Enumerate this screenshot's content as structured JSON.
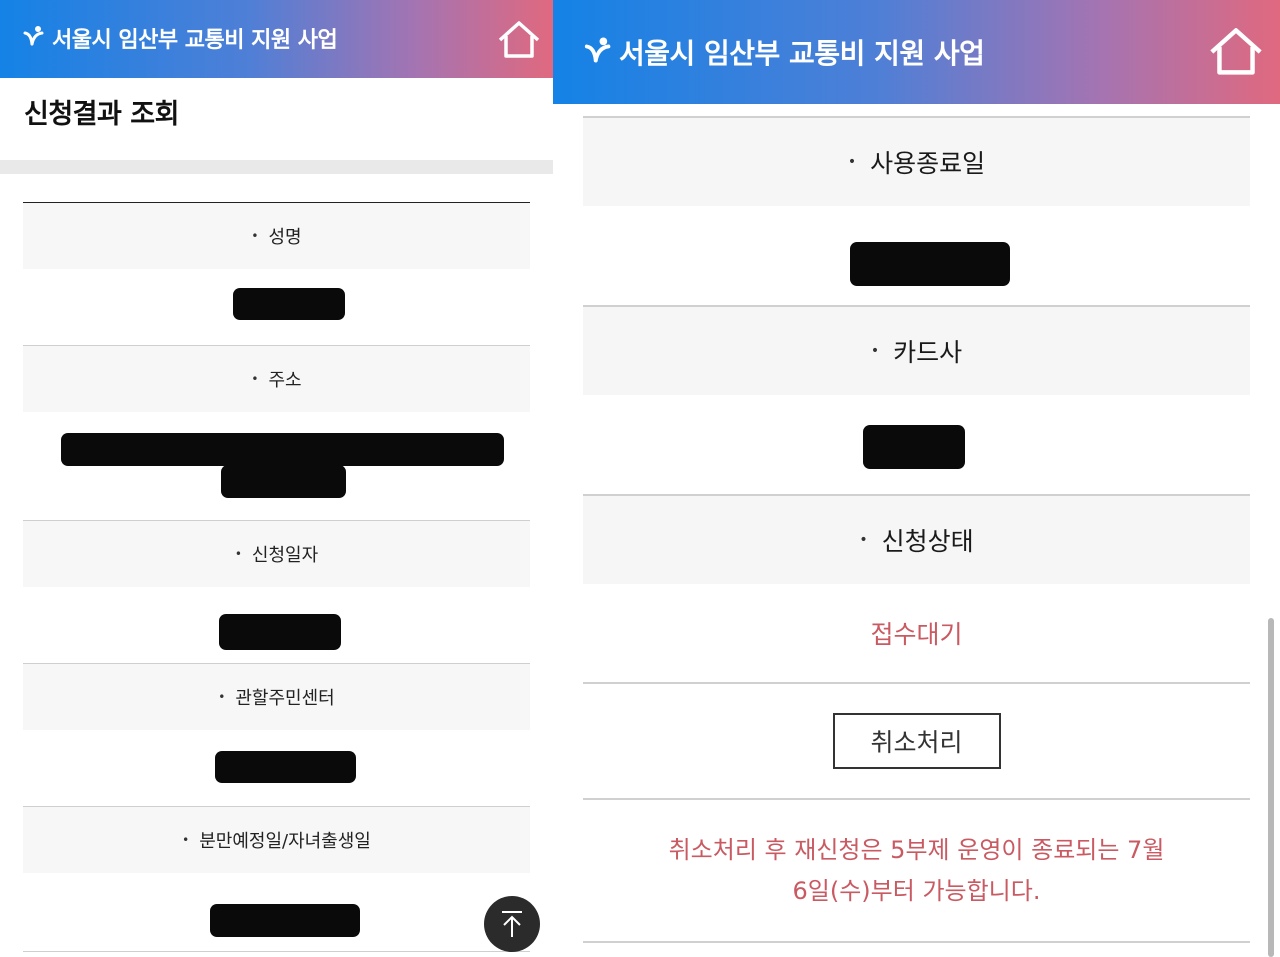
{
  "app": {
    "title": "서울시 임산부 교통비 지원 사업",
    "home_icon": "home-icon",
    "brand_icon": "seoul-logo-icon"
  },
  "left_screen": {
    "page_title": "신청결과 조회",
    "rows": [
      {
        "label": "성명"
      },
      {
        "label": "주소"
      },
      {
        "label": "신청일자"
      },
      {
        "label": "관할주민센터"
      },
      {
        "label": "분만예정일/자녀출생일"
      }
    ],
    "scroll_top_icon": "arrow-up-to-top-icon"
  },
  "right_screen": {
    "rows": [
      {
        "label": "사용종료일"
      },
      {
        "label": "카드사"
      },
      {
        "label": "신청상태"
      }
    ],
    "status_value": "접수대기",
    "cancel_button": "취소처리",
    "notice_line1": "취소처리 후 재신청은 5부제 운영이 종료되는 7월",
    "notice_line2": "6일(수)부터 가능합니다."
  },
  "colors": {
    "header_gradient_start": "#1482e6",
    "header_gradient_end": "#e0697f",
    "status_text": "#c95a62"
  }
}
